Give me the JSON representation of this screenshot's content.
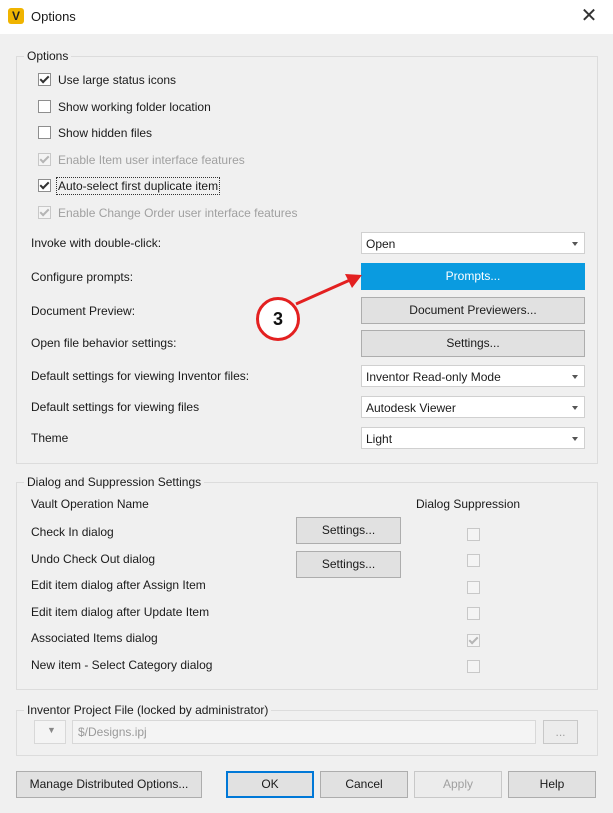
{
  "window": {
    "title": "Options",
    "app_icon_letter": "V"
  },
  "options_group": {
    "label": "Options",
    "checkboxes": [
      {
        "label": "Use large status icons",
        "checked": true,
        "disabled": false
      },
      {
        "label": "Show working folder location",
        "checked": false,
        "disabled": false
      },
      {
        "label": "Show hidden files",
        "checked": false,
        "disabled": false
      },
      {
        "label": "Enable Item user interface features",
        "checked": true,
        "disabled": true
      },
      {
        "label": "Auto-select first duplicate item",
        "checked": true,
        "disabled": false
      },
      {
        "label": "Enable Change Order user interface features",
        "checked": true,
        "disabled": true
      }
    ],
    "invoke_label": "Invoke with double-click:",
    "invoke_value": "Open",
    "configure_label": "Configure prompts:",
    "prompts_button": "Prompts...",
    "preview_label": "Document Preview:",
    "previewers_button": "Document Previewers...",
    "open_behavior_label": "Open file behavior settings:",
    "open_behavior_button": "Settings...",
    "inventor_view_label": "Default settings for viewing Inventor files:",
    "inventor_view_value": "Inventor Read-only Mode",
    "files_view_label": "Default settings for viewing files",
    "files_view_value": "Autodesk Viewer",
    "theme_label": "Theme",
    "theme_value": "Light"
  },
  "callout": {
    "number": "3",
    "color": "#e32020"
  },
  "dialog_group": {
    "label": "Dialog and Suppression Settings",
    "col_name": "Vault Operation Name",
    "col_suppression": "Dialog Suppression",
    "rows": [
      {
        "name": "Check In dialog",
        "button": "Settings...",
        "checked": false
      },
      {
        "name": "Undo Check Out dialog",
        "button": "Settings...",
        "checked": false
      },
      {
        "name": "Edit item dialog after Assign Item",
        "button": "",
        "checked": false
      },
      {
        "name": "Edit item dialog after Update Item",
        "button": "",
        "checked": false
      },
      {
        "name": "Associated Items dialog",
        "button": "",
        "checked": true
      },
      {
        "name": "New item - Select Category dialog",
        "button": "",
        "checked": false
      }
    ]
  },
  "project_group": {
    "label": "Inventor Project File (locked by administrator)",
    "value": "$/Designs.ipj",
    "browse_label": "..."
  },
  "footer": {
    "manage": "Manage Distributed Options...",
    "ok": "OK",
    "cancel": "Cancel",
    "apply": "Apply",
    "help": "Help"
  },
  "colors": {
    "accent": "#0a9be0",
    "focus": "#0078d7"
  }
}
